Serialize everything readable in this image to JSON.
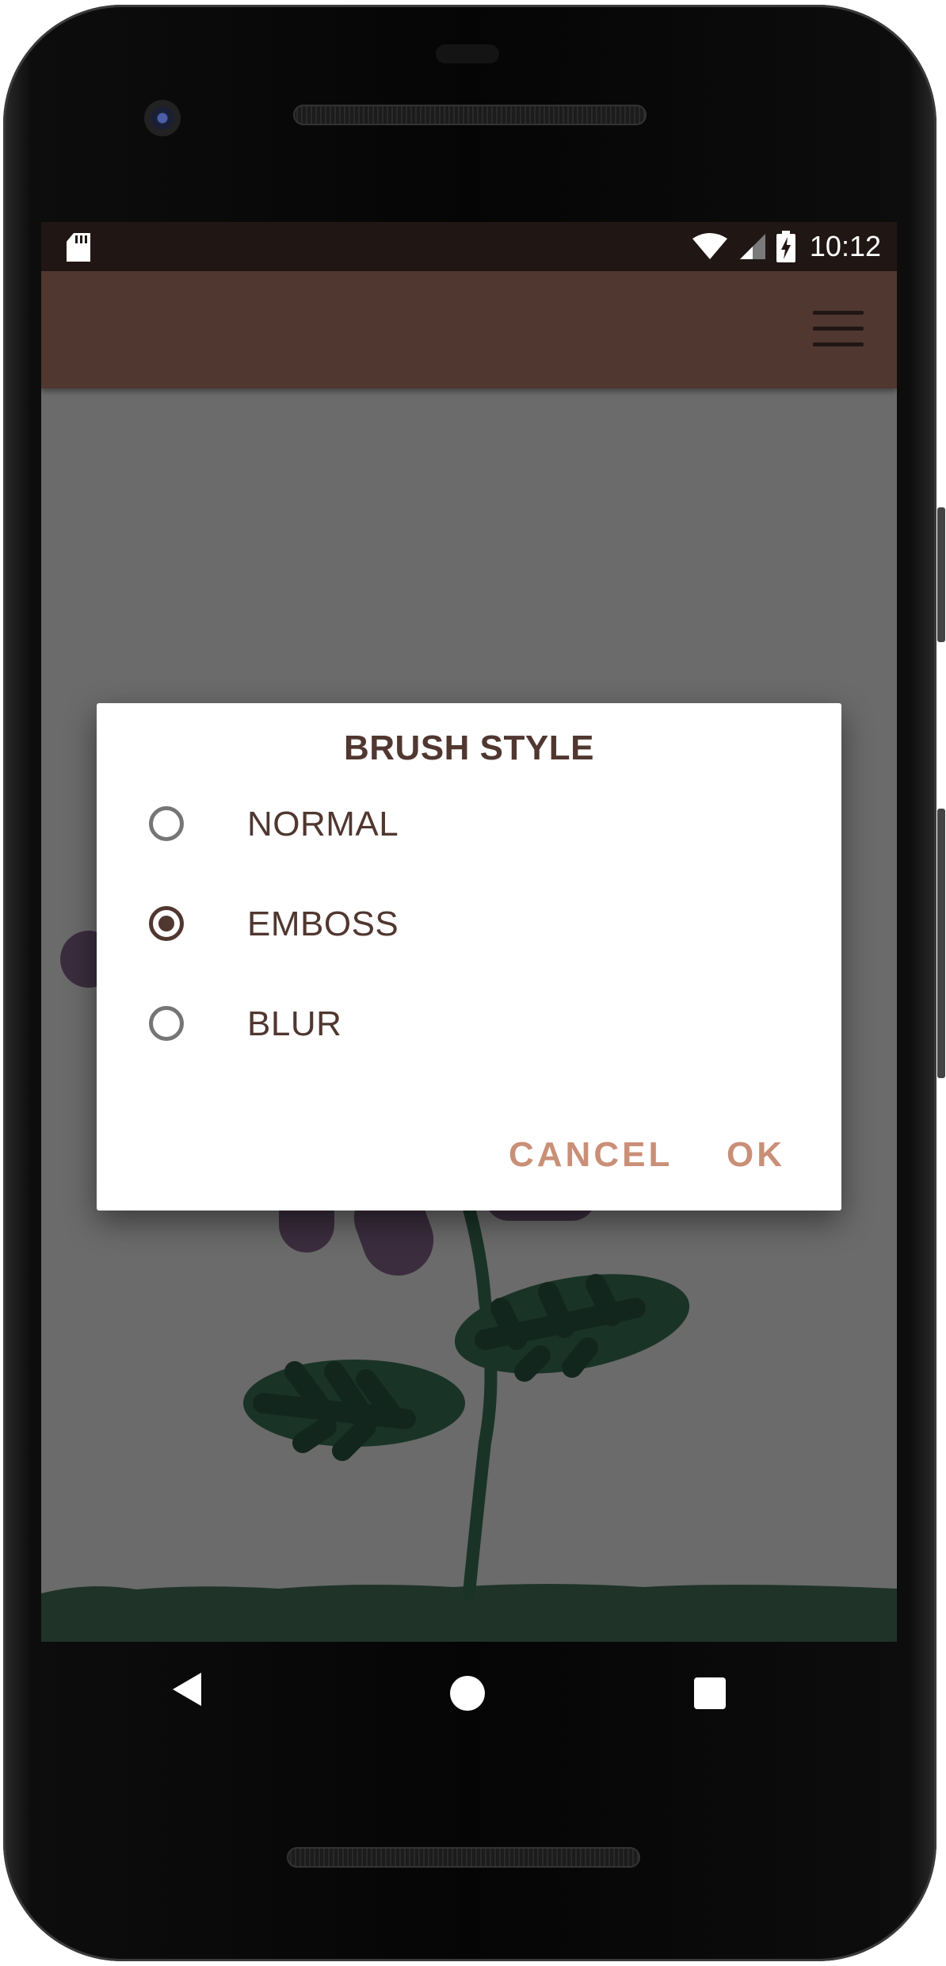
{
  "status_bar": {
    "time": "10:12",
    "icons": [
      "sd-card-icon",
      "wifi-icon",
      "cell-signal-icon",
      "battery-charging-icon"
    ]
  },
  "app_bar": {
    "menu_icon": "hamburger-menu-icon",
    "color": "#503730"
  },
  "dialog": {
    "title": "BRUSH STYLE",
    "options": [
      {
        "label": "NORMAL",
        "selected": false
      },
      {
        "label": "EMBOSS",
        "selected": true
      },
      {
        "label": "BLUR",
        "selected": false
      }
    ],
    "cancel_label": "CANCEL",
    "ok_label": "OK",
    "accent_color": "#c98f77",
    "text_color": "#503730"
  },
  "navigation_bar": {
    "buttons": [
      "back-icon",
      "home-icon",
      "recents-icon"
    ]
  }
}
